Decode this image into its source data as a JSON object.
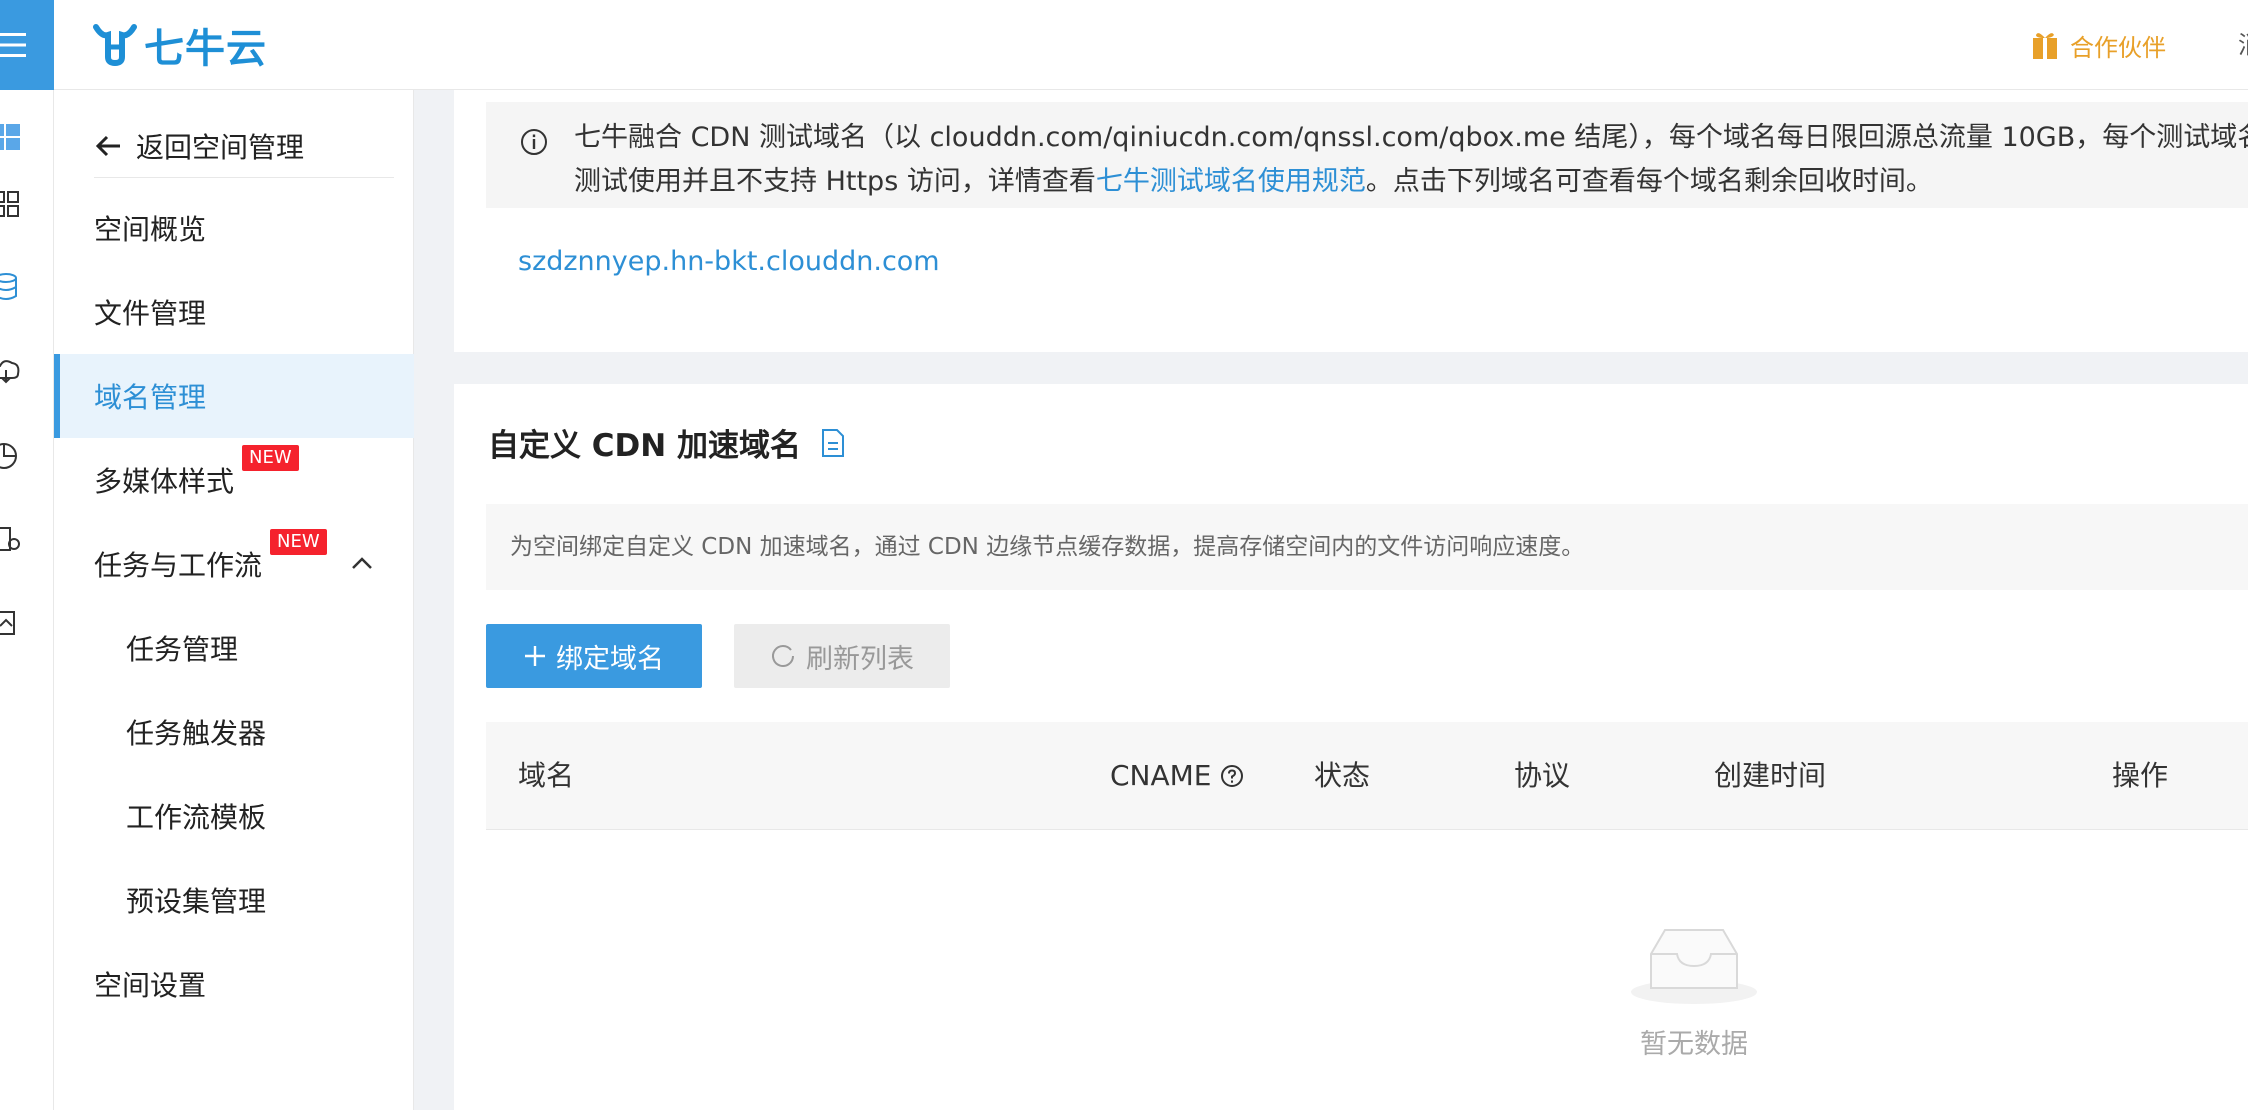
{
  "app": {
    "logo_text": "七牛云",
    "partner_label": "合作伙伴",
    "top_cut_text": "消"
  },
  "sidebar": {
    "back_label": "返回空间管理",
    "items": [
      {
        "label": "空间概览"
      },
      {
        "label": "文件管理"
      },
      {
        "label": "域名管理"
      },
      {
        "label": "多媒体样式",
        "badge": "NEW"
      },
      {
        "label": "任务与工作流",
        "badge": "NEW"
      },
      {
        "label": "任务管理"
      },
      {
        "label": "任务触发器"
      },
      {
        "label": "工作流模板"
      },
      {
        "label": "预设集管理"
      },
      {
        "label": "空间设置"
      }
    ]
  },
  "test_domains": {
    "notice_line1": "七牛融合 CDN 测试域名（以 clouddn.com/qiniucdn.com/qnssl.com/qbox.me 结尾），每个域名每日限回源总流量 10GB，每个测试域名",
    "notice_line2_prefix": "测试使用并且不支持 Https 访问，详情查看",
    "notice_link": "七牛测试域名使用规范",
    "notice_line2_suffix": "。点击下列域名可查看每个域名剩余回收时间。",
    "domain": "szdznnyep.hn-bkt.clouddn.com"
  },
  "custom": {
    "title": "自定义 CDN 加速域名",
    "description": "为空间绑定自定义 CDN 加速域名，通过 CDN 边缘节点缓存数据，提高存储空间内的文件访问响应速度。",
    "bind_button": "绑定域名",
    "refresh_button": "刷新列表",
    "columns": [
      "域名",
      "CNAME",
      "状态",
      "协议",
      "创建时间",
      "操作"
    ],
    "empty_text": "暂无数据"
  },
  "colors": {
    "primary": "#3a9ae0",
    "link": "#2d8fd5",
    "badge": "#f5222d",
    "partner": "#e8a029"
  }
}
